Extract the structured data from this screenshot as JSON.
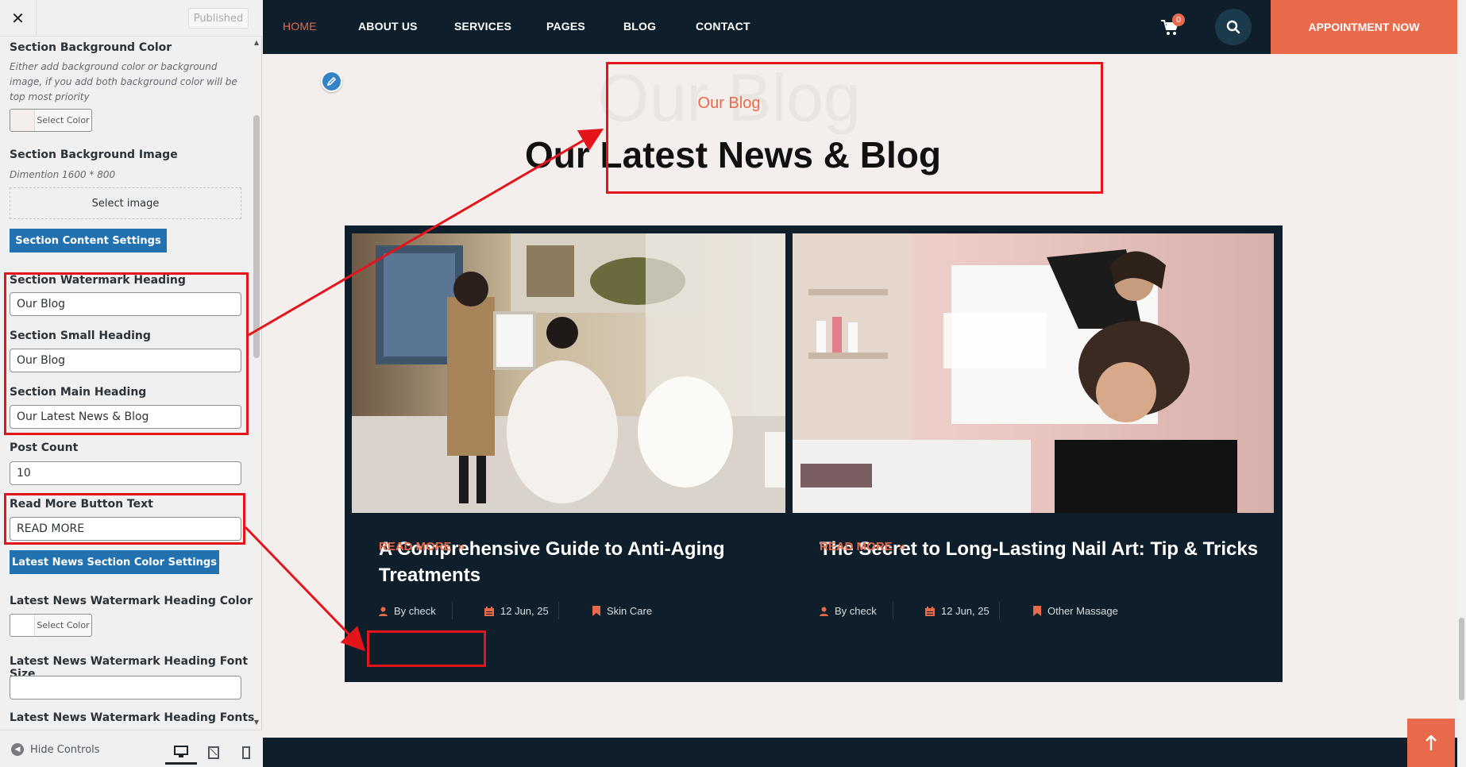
{
  "customizer": {
    "close_icon": "close-icon",
    "published_label": "Published",
    "bg_color": {
      "label": "Section Background Color",
      "description": "Either add background color or background image, if you add both background color will be top most priority",
      "button_label": "Select Color"
    },
    "bg_image": {
      "label": "Section Background Image",
      "description": "Dimention 1600 * 800",
      "button_label": "Select image"
    },
    "content_settings_button": "Section Content Settings",
    "watermark_heading": {
      "label": "Section Watermark Heading",
      "value": "Our Blog"
    },
    "small_heading": {
      "label": "Section Small Heading",
      "value": "Our Blog"
    },
    "main_heading": {
      "label": "Section Main Heading",
      "value": "Our Latest News & Blog"
    },
    "post_count": {
      "label": "Post Count",
      "value": "10"
    },
    "read_more_text": {
      "label": "Read More Button Text",
      "value": "READ MORE"
    },
    "color_settings_button": "Latest News Section Color Settings",
    "watermark_color": {
      "label": "Latest News Watermark Heading Color",
      "button_label": "Select Color"
    },
    "watermark_font_size": {
      "label": "Latest News Watermark Heading Font Size",
      "value": ""
    },
    "watermark_fonts": {
      "label": "Latest News Watermark Heading Fonts"
    },
    "footer": {
      "hide_controls": "Hide Controls",
      "devices": [
        "desktop-icon",
        "tablet-icon",
        "mobile-icon"
      ]
    }
  },
  "site": {
    "nav": {
      "items": [
        "HOME",
        "ABOUT US",
        "SERVICES",
        "PAGES",
        "BLOG",
        "CONTACT"
      ],
      "active_index": 0,
      "cart_count": "0",
      "cta": "APPOINTMENT NOW"
    },
    "section": {
      "watermark": "Our Blog",
      "small_heading": "Our Blog",
      "main_heading": "Our Latest News & Blog"
    },
    "posts": [
      {
        "title": "A Comprehensive Guide to Anti-Aging Treatments",
        "author": "By check",
        "date": "12 Jun, 25",
        "category": "Skin Care",
        "read_more": "READ MORE"
      },
      {
        "title": "The Secret to Long-Lasting Nail Art: Tip & Tricks",
        "author": "By check",
        "date": "12 Jun, 25",
        "category": "Other Massage",
        "read_more": "READ MORE"
      }
    ]
  },
  "colors": {
    "accent": "#e86a4b",
    "navy": "#0e1f2b",
    "wp_blue": "#2271b1",
    "annotation_red": "#e3151a"
  }
}
